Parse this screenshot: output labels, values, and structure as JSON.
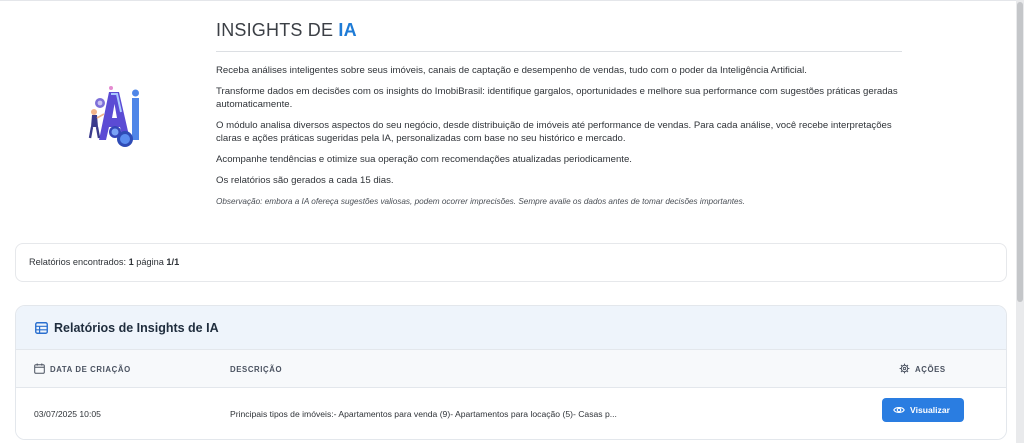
{
  "header": {
    "title_main": "INSIGHTS DE ",
    "title_accent": "IA"
  },
  "intro": {
    "p1": "Receba análises inteligentes sobre seus imóveis, canais de captação e desempenho de vendas, tudo com o poder da Inteligência Artificial.",
    "p2": "Transforme dados em decisões com os insights do ImobiBrasil: identifique gargalos, oportunidades e melhore sua performance com sugestões práticas geradas automaticamente.",
    "p3": "O módulo analisa diversos aspectos do seu negócio, desde distribuição de imóveis até performance de vendas. Para cada análise, você recebe interpretações claras e ações práticas sugeridas pela IA, personalizadas com base no seu histórico e mercado.",
    "p4": "Acompanhe tendências e otimize sua operação com recomendações atualizadas periodicamente.",
    "p5": "Os relatórios são gerados a cada 15 dias.",
    "note": "Observação: embora a IA ofereça sugestões valiosas, podem ocorrer imprecisões. Sempre avalie os dados antes de tomar decisões importantes."
  },
  "counter": {
    "label": "Relatórios encontrados: ",
    "count": "1",
    "page_label": " página ",
    "page_value": "1/1"
  },
  "reports": {
    "title": "Relatórios de Insights de IA",
    "columns": {
      "date": "DATA DE CRIAÇÃO",
      "description": "DESCRIÇÃO",
      "actions": "AÇÕES"
    },
    "rows": [
      {
        "date": "03/07/2025 10:05",
        "description": "Principais tipos de imóveis:- Apartamentos para venda (9)- Apartamentos para locação (5)- Casas p...",
        "action_label": "Visualizar"
      }
    ]
  },
  "icons": {
    "illustration": "ai-illustration-icon",
    "table": "table-grid-icon",
    "calendar": "calendar-icon",
    "actions": "gear-icon",
    "view": "eye-icon"
  },
  "colors": {
    "accent": "#1e7bd6",
    "button": "#2a7de1",
    "header_bg": "#eef4fb"
  }
}
